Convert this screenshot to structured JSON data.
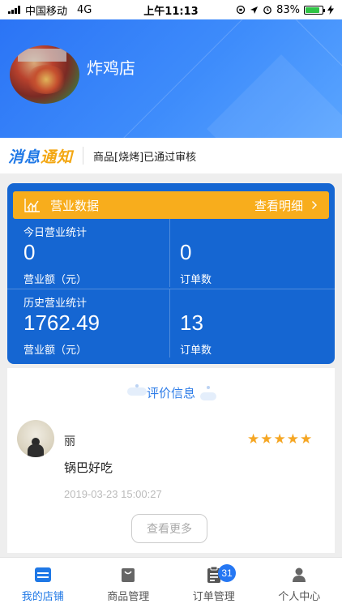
{
  "status_bar": {
    "carrier": "中国移动",
    "network": "4G",
    "time": "上午11:13",
    "battery_percent": "83%",
    "battery_level": 0.83
  },
  "shop": {
    "name": "炸鸡店"
  },
  "notice": {
    "logo_part1": "消息",
    "logo_part2": "通知",
    "message": "商品[烧烤]已通过审核"
  },
  "business": {
    "title": "营业数据",
    "detail_label": "查看明细",
    "today": {
      "section_label": "今日营业统计",
      "revenue_value": "0",
      "revenue_label": "营业额（元）",
      "orders_value": "0",
      "orders_label": "订单数"
    },
    "history": {
      "section_label": "历史营业统计",
      "revenue_value": "1762.49",
      "revenue_label": "营业额（元）",
      "orders_value": "13",
      "orders_label": "订单数"
    }
  },
  "reviews": {
    "title": "评价信息",
    "items": [
      {
        "user": "丽",
        "rating": 5,
        "content": "锅巴好吃",
        "time": "2019-03-23 15:00:27"
      }
    ],
    "more_label": "查看更多"
  },
  "tabs": [
    {
      "label": "我的店铺",
      "icon": "store-icon",
      "active": true
    },
    {
      "label": "商品管理",
      "icon": "bag-icon",
      "active": false
    },
    {
      "label": "订单管理",
      "icon": "clipboard-icon",
      "active": false,
      "badge": "31"
    },
    {
      "label": "个人中心",
      "icon": "person-icon",
      "active": false
    }
  ],
  "colors": {
    "primary_blue": "#1f78e6",
    "card_blue": "#1566d2",
    "accent_orange": "#f8ad1c",
    "star": "#f5a623"
  }
}
